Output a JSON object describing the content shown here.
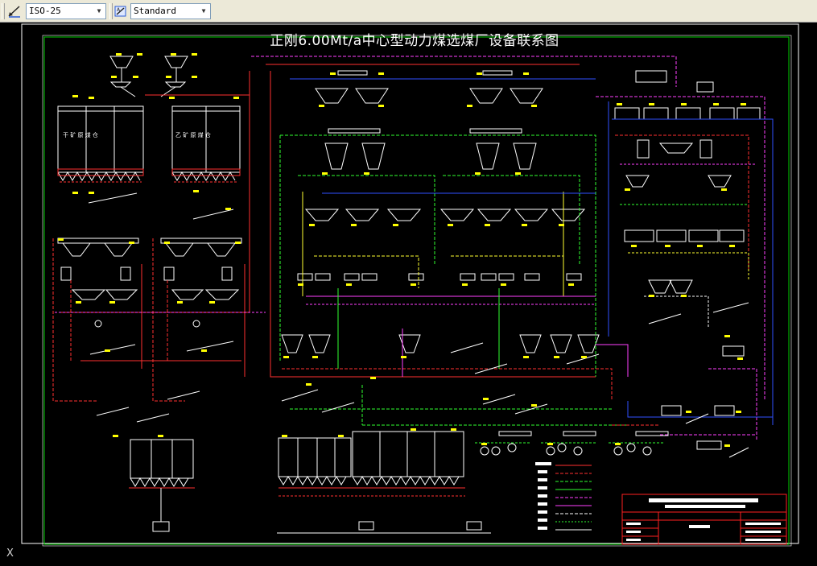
{
  "toolbar": {
    "dim_style": "ISO-25",
    "text_style": "Standard",
    "icons": [
      "dimension-style-icon",
      "text-style-icon"
    ]
  },
  "drawing": {
    "title": "正刚6.00Mt/a中心型动力煤选煤厂设备联系图",
    "bin_labels_left_a": "干 矿 原 煤 仓",
    "bin_labels_left_b": "乙 矿 原 煤 仓",
    "ucs_marker": "X"
  },
  "colors": {
    "background": "#000000",
    "frame_green": "#00cc00",
    "frame_white": "#ffffff",
    "equipment_white": "#ffffff",
    "line_red": "#ff3030",
    "line_magenta": "#ff40ff",
    "line_green": "#30ff30",
    "line_yellow": "#ffff30",
    "line_blue": "#3050ff",
    "label_yellow": "#ffff00",
    "title_block_red": "#ff2020"
  }
}
